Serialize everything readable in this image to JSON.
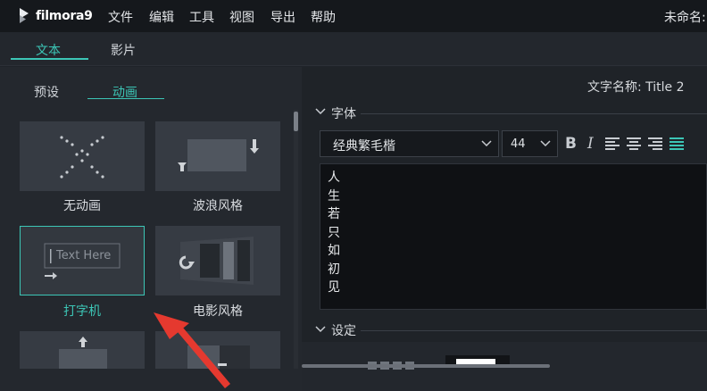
{
  "app": {
    "logo_text": "filmora9",
    "project_name": "未命名:"
  },
  "menu": [
    "文件",
    "编辑",
    "工具",
    "视图",
    "导出",
    "帮助"
  ],
  "top_tabs": [
    {
      "label": "文本",
      "active": true
    },
    {
      "label": "影片",
      "active": false
    }
  ],
  "sub_tabs": [
    {
      "label": "预设",
      "active": false
    },
    {
      "label": "动画",
      "active": true
    }
  ],
  "animations": [
    {
      "label": "无动画",
      "icon": "no-animation-icon",
      "selected": false
    },
    {
      "label": "波浪风格",
      "icon": "wave-style-icon",
      "selected": false
    },
    {
      "label": "打字机",
      "icon": "typewriter-icon",
      "selected": true,
      "preview_text": "Text Here"
    },
    {
      "label": "电影风格",
      "icon": "film-style-icon",
      "selected": false
    }
  ],
  "right": {
    "title_name_label": "文字名称: Title 2",
    "font_section": "字体",
    "font_family": "经典繁毛楷",
    "font_size": "44",
    "bold": "B",
    "italic": "I",
    "text_lines": [
      "人",
      "生",
      "若",
      "只",
      "如",
      "初",
      "见"
    ],
    "settings_section": "设定"
  },
  "colors": {
    "accent": "#3cc6b6",
    "annotation_arrow": "#e5392f",
    "background": "#1f2329"
  }
}
